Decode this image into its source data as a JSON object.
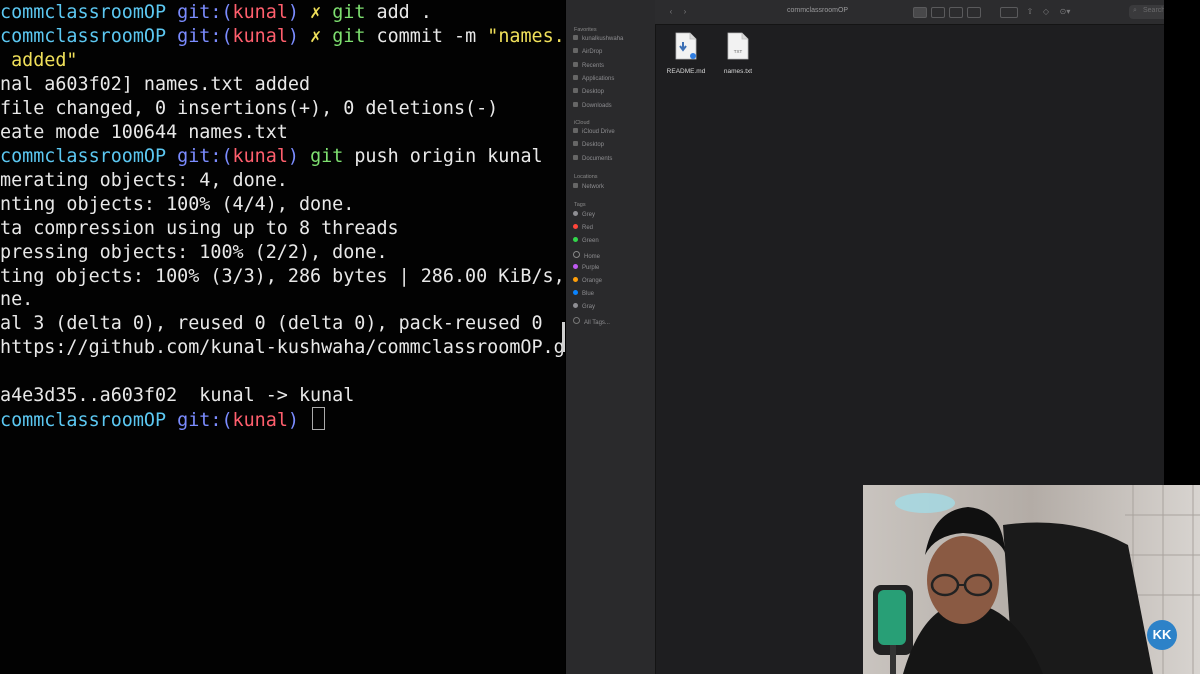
{
  "terminal": {
    "lines": [
      {
        "segments": [
          {
            "text": "commclassroomOP ",
            "color": "cyan"
          },
          {
            "text": "git:(",
            "color": "blue"
          },
          {
            "text": "kunal",
            "color": "red"
          },
          {
            "text": ") ",
            "color": "blue"
          },
          {
            "text": "✗ ",
            "color": "yellow"
          },
          {
            "text": "git ",
            "color": "green"
          },
          {
            "text": "add .",
            "color": "white"
          }
        ]
      },
      {
        "segments": [
          {
            "text": "commclassroomOP ",
            "color": "cyan"
          },
          {
            "text": "git:(",
            "color": "blue"
          },
          {
            "text": "kunal",
            "color": "red"
          },
          {
            "text": ") ",
            "color": "blue"
          },
          {
            "text": "✗ ",
            "color": "yellow"
          },
          {
            "text": "git ",
            "color": "green"
          },
          {
            "text": "commit -m ",
            "color": "white"
          },
          {
            "text": "\"names.",
            "color": "yellow"
          }
        ]
      },
      {
        "segments": [
          {
            "text": " added\"",
            "color": "yellow"
          }
        ]
      },
      {
        "segments": [
          {
            "text": "nal a603f02] names.txt added",
            "color": "white"
          }
        ]
      },
      {
        "segments": [
          {
            "text": "file changed, 0 insertions(+), 0 deletions(-)",
            "color": "white"
          }
        ]
      },
      {
        "segments": [
          {
            "text": "eate mode 100644 names.txt",
            "color": "white"
          }
        ]
      },
      {
        "segments": [
          {
            "text": "commclassroomOP ",
            "color": "cyan"
          },
          {
            "text": "git:(",
            "color": "blue"
          },
          {
            "text": "kunal",
            "color": "red"
          },
          {
            "text": ") ",
            "color": "blue"
          },
          {
            "text": "git ",
            "color": "green"
          },
          {
            "text": "push origin kunal",
            "color": "white"
          }
        ]
      },
      {
        "segments": [
          {
            "text": "merating objects: 4, done.",
            "color": "white"
          }
        ]
      },
      {
        "segments": [
          {
            "text": "nting objects: 100% (4/4), done.",
            "color": "white"
          }
        ]
      },
      {
        "segments": [
          {
            "text": "ta compression using up to 8 threads",
            "color": "white"
          }
        ]
      },
      {
        "segments": [
          {
            "text": "pressing objects: 100% (2/2), done.",
            "color": "white"
          }
        ]
      },
      {
        "segments": [
          {
            "text": "ting objects: 100% (3/3), 286 bytes | 286.00 KiB/s,",
            "color": "white"
          }
        ]
      },
      {
        "segments": [
          {
            "text": "ne.",
            "color": "white"
          }
        ]
      },
      {
        "segments": [
          {
            "text": "al 3 (delta 0), reused 0 (delta 0), pack-reused 0",
            "color": "white"
          }
        ]
      },
      {
        "segments": [
          {
            "text": "https://github.com/kunal-kushwaha/commclassroomOP.g",
            "color": "white"
          }
        ]
      },
      {
        "segments": [
          {
            "text": "",
            "color": "white"
          }
        ]
      },
      {
        "segments": [
          {
            "text": "a4e3d35..a603f02  kunal -> kunal",
            "color": "white"
          }
        ]
      },
      {
        "segments": [
          {
            "text": "commclassroomOP ",
            "color": "cyan"
          },
          {
            "text": "git:(",
            "color": "blue"
          },
          {
            "text": "kunal",
            "color": "red"
          },
          {
            "text": ") ",
            "color": "blue"
          }
        ],
        "cursor": true
      }
    ]
  },
  "finder": {
    "title": "commclassroomOP",
    "search_placeholder": "Search",
    "sidebar": {
      "favorites_header": "Favorites",
      "favorites": [
        "kunalkushwaha",
        "AirDrop",
        "Recents",
        "Applications",
        "Desktop",
        "Downloads"
      ],
      "icloud_header": "iCloud",
      "icloud": [
        "iCloud Drive",
        "Desktop",
        "Documents"
      ],
      "locations_header": "Locations",
      "locations": [
        "Network"
      ],
      "tags_header": "Tags",
      "tags": [
        {
          "label": "Grey",
          "color": "#8e8e93"
        },
        {
          "label": "Red",
          "color": "#ff453a"
        },
        {
          "label": "Green",
          "color": "#32d74b"
        },
        {
          "label": "Home",
          "color": "#2a2a2c"
        },
        {
          "label": "Purple",
          "color": "#bf5af2"
        },
        {
          "label": "Orange",
          "color": "#ff9f0a"
        },
        {
          "label": "Blue",
          "color": "#0a84ff"
        },
        {
          "label": "Gray",
          "color": "#8e8e93"
        },
        {
          "label": "All Tags...",
          "color": ""
        }
      ]
    },
    "files": [
      {
        "name": "README.md",
        "icon": "markdown-file-icon"
      },
      {
        "name": "names.txt",
        "icon": "text-file-icon",
        "badge": "TXT"
      }
    ]
  },
  "webcam": {
    "description": "presenter webcam overlay"
  },
  "logo": {
    "text": "KK"
  },
  "colors": {
    "cyan": "#5cc8f2",
    "blue": "#7b8cff",
    "red": "#ff5f6d",
    "yellow": "#f0e05a",
    "green": "#7ee070",
    "white": "#e8e8e8"
  }
}
